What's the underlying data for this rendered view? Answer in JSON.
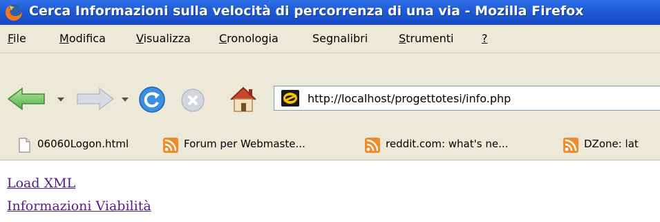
{
  "window": {
    "title": "Cerca Informazioni sulla velocità di percorrenza di una via - Mozilla Firefox",
    "icon": "firefox-icon"
  },
  "menu": [
    {
      "label": "File",
      "accel": "F"
    },
    {
      "label": "Modifica",
      "accel": "M"
    },
    {
      "label": "Visualizza",
      "accel": "V"
    },
    {
      "label": "Cronologia",
      "accel": "C"
    },
    {
      "label": "Segnalibri",
      "accel": "g"
    },
    {
      "label": "Strumenti",
      "accel": "S"
    },
    {
      "label": "?",
      "accel": "?"
    }
  ],
  "toolbar": {
    "back_icon": "back-arrow-icon",
    "forward_icon": "forward-arrow-icon",
    "reload_icon": "reload-icon",
    "stop_icon": "stop-icon",
    "home_icon": "home-icon",
    "url": "http://localhost/progettotesi/info.php"
  },
  "bookmarks": [
    {
      "label": "06060Logon.html",
      "icon": "page-icon"
    },
    {
      "label": "Forum per Webmaste...",
      "icon": "rss-feed-icon"
    },
    {
      "label": "reddit.com: what's ne...",
      "icon": "rss-feed-icon"
    },
    {
      "label": "DZone: lat",
      "icon": "rss-feed-icon"
    }
  ],
  "content": {
    "links": [
      {
        "label": "Load XML"
      },
      {
        "label": "Informazioni Viabilità"
      }
    ]
  },
  "colors": {
    "titlebar": "#1e5bd6",
    "chrome": "#ece9d8",
    "visited_link": "#551a8b"
  }
}
